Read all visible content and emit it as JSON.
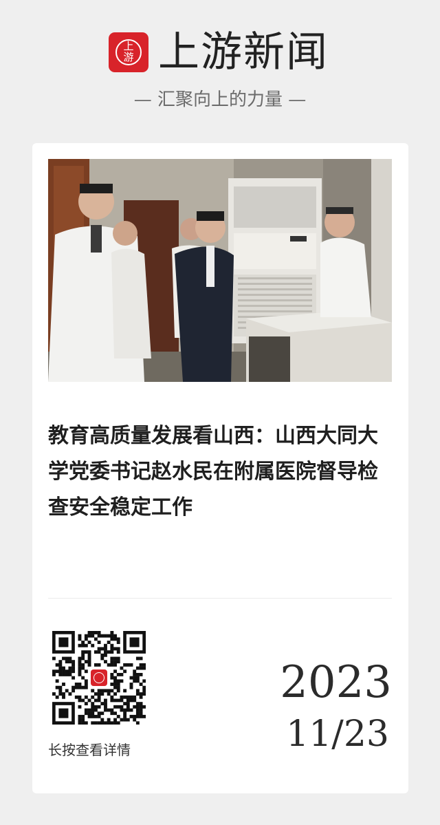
{
  "header": {
    "brand_name": "上游新闻",
    "logo_mark": "上游",
    "slogan": "— 汇聚向上的力量 —"
  },
  "article": {
    "photo_description": "officials-inspecting-equipment-photo",
    "headline": "教育高质量发展看山西：山西大同大学党委书记赵水民在附属医院督导检查安全稳定工作"
  },
  "footer": {
    "qr_caption": "长按查看详情",
    "year": "2023",
    "month_day": "11/23"
  },
  "colors": {
    "brand_red": "#d8232a",
    "page_background": "#efefef",
    "card_background": "#ffffff"
  }
}
